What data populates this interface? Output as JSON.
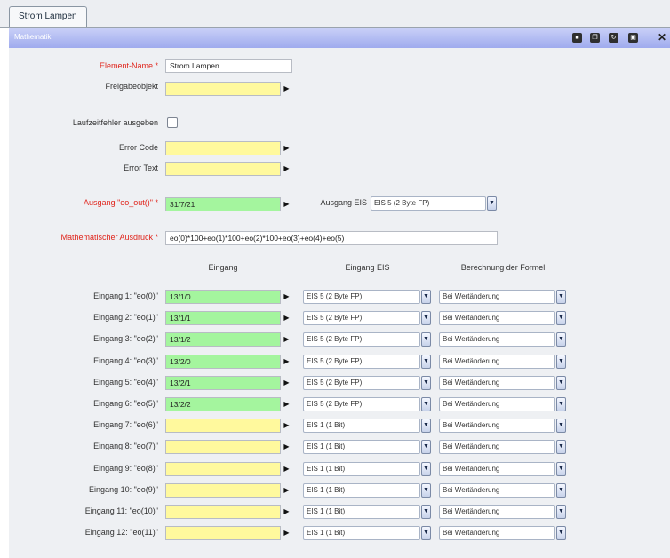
{
  "tab": {
    "label": "Strom Lampen"
  },
  "panel": {
    "title": "Mathematik"
  },
  "toolbar": {
    "icons": [
      "delete-icon",
      "copy-icon",
      "refresh-icon",
      "save-icon"
    ],
    "close_label": "✕"
  },
  "form": {
    "element_name": {
      "label": "Element-Name *",
      "value": "Strom Lampen"
    },
    "freigabe": {
      "label": "Freigabeobjekt",
      "value": ""
    },
    "laufzeitfehler": {
      "label": "Laufzeitfehler ausgeben",
      "checked": false
    },
    "error_code": {
      "label": "Error Code",
      "value": ""
    },
    "error_text": {
      "label": "Error Text",
      "value": ""
    },
    "ausgang": {
      "label": "Ausgang \"eo_out()\" *",
      "value": "31/7/21"
    },
    "ausgang_eis": {
      "label": "Ausgang EIS",
      "value": "EIS 5 (2 Byte FP)"
    },
    "ausdruck": {
      "label": "Mathematischer Ausdruck *",
      "value": "eo(0)*100+eo(1)*100+eo(2)*100+eo(3)+eo(4)+eo(5)"
    }
  },
  "columns": {
    "eingang": "Eingang",
    "eis": "Eingang EIS",
    "berechnung": "Berechnung der Formel"
  },
  "inputs": [
    {
      "label": "Eingang 1: \"eo(0)\"",
      "value": "13/1/0",
      "color": "green",
      "eis": "EIS 5 (2 Byte FP)",
      "calc": "Bei Wertänderung"
    },
    {
      "label": "Eingang 2: \"eo(1)\"",
      "value": "13/1/1",
      "color": "green",
      "eis": "EIS 5 (2 Byte FP)",
      "calc": "Bei Wertänderung"
    },
    {
      "label": "Eingang 3: \"eo(2)\"",
      "value": "13/1/2",
      "color": "green",
      "eis": "EIS 5 (2 Byte FP)",
      "calc": "Bei Wertänderung"
    },
    {
      "label": "Eingang 4: \"eo(3)\"",
      "value": "13/2/0",
      "color": "green",
      "eis": "EIS 5 (2 Byte FP)",
      "calc": "Bei Wertänderung"
    },
    {
      "label": "Eingang 5: \"eo(4)\"",
      "value": "13/2/1",
      "color": "green",
      "eis": "EIS 5 (2 Byte FP)",
      "calc": "Bei Wertänderung"
    },
    {
      "label": "Eingang 6: \"eo(5)\"",
      "value": "13/2/2",
      "color": "green",
      "eis": "EIS 5 (2 Byte FP)",
      "calc": "Bei Wertänderung"
    },
    {
      "label": "Eingang 7: \"eo(6)\"",
      "value": "",
      "color": "yellow",
      "eis": "EIS 1 (1 Bit)",
      "calc": "Bei Wertänderung"
    },
    {
      "label": "Eingang 8: \"eo(7)\"",
      "value": "",
      "color": "yellow",
      "eis": "EIS 1 (1 Bit)",
      "calc": "Bei Wertänderung"
    },
    {
      "label": "Eingang 9: \"eo(8)\"",
      "value": "",
      "color": "yellow",
      "eis": "EIS 1 (1 Bit)",
      "calc": "Bei Wertänderung"
    },
    {
      "label": "Eingang 10: \"eo(9)\"",
      "value": "",
      "color": "yellow",
      "eis": "EIS 1 (1 Bit)",
      "calc": "Bei Wertänderung"
    },
    {
      "label": "Eingang 11: \"eo(10)\"",
      "value": "",
      "color": "yellow",
      "eis": "EIS 1 (1 Bit)",
      "calc": "Bei Wertänderung"
    },
    {
      "label": "Eingang 12: \"eo(11)\"",
      "value": "",
      "color": "yellow",
      "eis": "EIS 1 (1 Bit)",
      "calc": "Bei Wertänderung"
    }
  ],
  "colors": {
    "yellow_field": "#fff99d",
    "green_field": "#a4f59e",
    "required_label": "#e0241b",
    "header_bar": "#9fabee"
  }
}
